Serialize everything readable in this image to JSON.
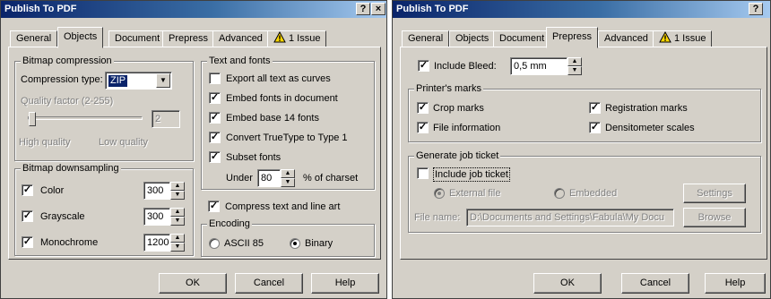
{
  "left": {
    "title": "Publish To PDF",
    "help_btn": "?",
    "close_btn": "×",
    "tabs": [
      "General",
      "Objects",
      "Document",
      "Prepress",
      "Advanced",
      "1 Issue"
    ],
    "bitmap_compression": {
      "group": "Bitmap compression",
      "type_label": "Compression type:",
      "type_value": "ZIP",
      "quality_label": "Quality factor (2-255)",
      "quality_value": "2",
      "high": "High quality",
      "low": "Low quality"
    },
    "downsampling": {
      "group": "Bitmap downsampling",
      "color_label": "Color",
      "color_value": "300",
      "gray_label": "Grayscale",
      "gray_value": "300",
      "mono_label": "Monochrome",
      "mono_value": "1200"
    },
    "text_fonts": {
      "group": "Text and fonts",
      "export_curves": "Export all text as curves",
      "embed_fonts": "Embed fonts in document",
      "embed_base14": "Embed base 14 fonts",
      "convert_tt": "Convert TrueType to Type 1",
      "subset": "Subset fonts",
      "under_label": "Under",
      "under_value": "80",
      "charset_label": "% of charset"
    },
    "compress_text": "Compress text and line art",
    "encoding": {
      "group": "Encoding",
      "ascii": "ASCII 85",
      "binary": "Binary"
    },
    "buttons": {
      "ok": "OK",
      "cancel": "Cancel",
      "help": "Help"
    }
  },
  "right": {
    "title": "Publish To PDF",
    "help_btn": "?",
    "close_btn": "×",
    "tabs": [
      "General",
      "Objects",
      "Document",
      "Prepress",
      "Advanced",
      "1 Issue"
    ],
    "include_bleed": "Include Bleed:",
    "bleed_value": "0,5 mm",
    "printers_marks": {
      "group": "Printer's marks",
      "crop": "Crop marks",
      "registration": "Registration marks",
      "file_info": "File information",
      "densitometer": "Densitometer scales"
    },
    "job_ticket": {
      "group": "Generate job ticket",
      "include": "Include job ticket",
      "external": "External file",
      "embedded": "Embedded",
      "settings": "Settings",
      "file_name_label": "File name:",
      "file_name_value": "D:\\Documents and Settings\\Fabula\\My Docu",
      "browse": "Browse"
    },
    "buttons": {
      "ok": "OK",
      "cancel": "Cancel",
      "help": "Help"
    }
  }
}
